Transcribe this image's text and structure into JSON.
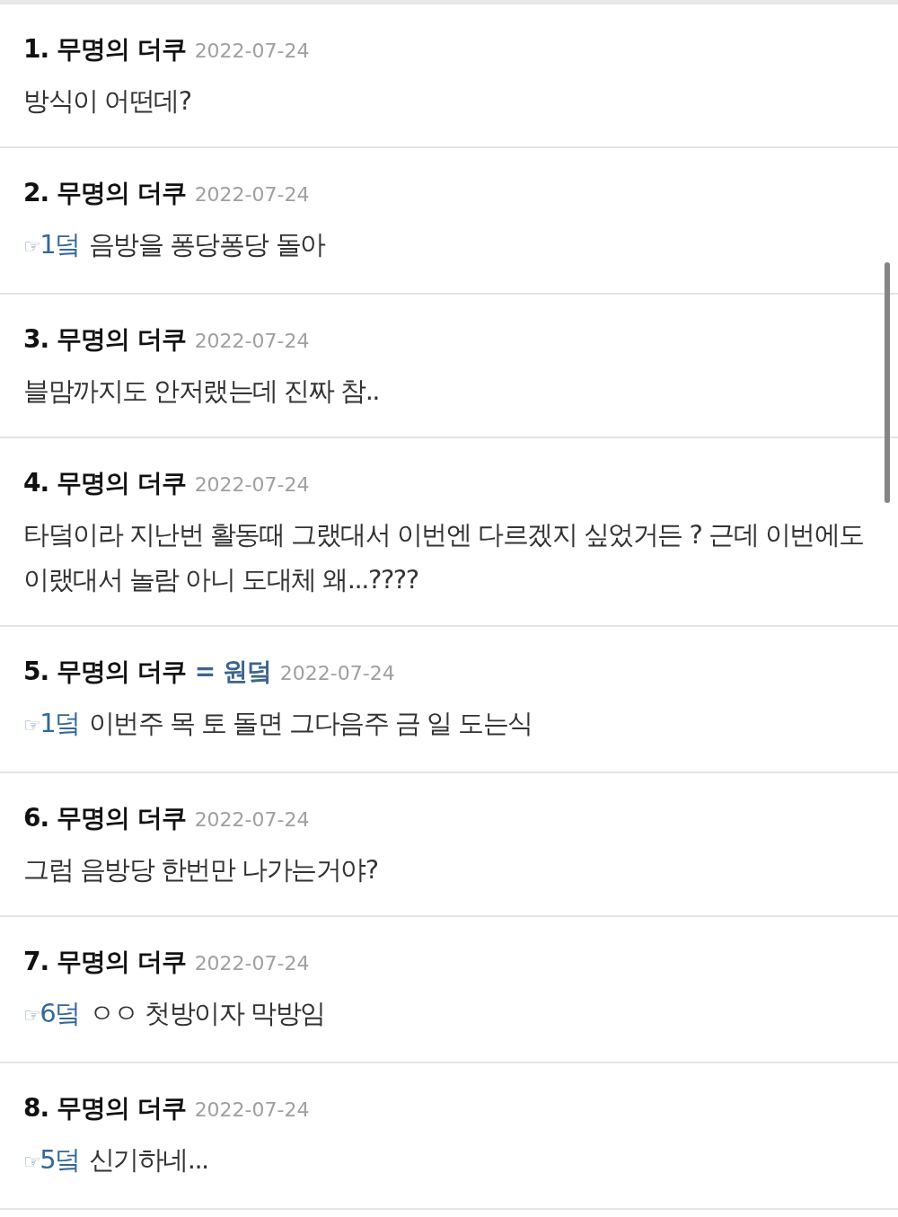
{
  "comments": [
    {
      "number": "1.",
      "author": "무명의 더쿠",
      "date": "2022-07-24",
      "text": "방식이 어떤데?"
    },
    {
      "number": "2.",
      "author": "무명의 더쿠",
      "date": "2022-07-24",
      "reply_icon": "☞",
      "reply_to": "1덬",
      "text": "음방을 퐁당퐁당 돌아"
    },
    {
      "number": "3.",
      "author": "무명의 더쿠",
      "date": "2022-07-24",
      "text": "블맘까지도 안저랬는데 진짜 참.."
    },
    {
      "number": "4.",
      "author": "무명의 더쿠",
      "date": "2022-07-24",
      "text": "타덬이라 지난번 활동때 그랬대서 이번엔 다르겠지 싶었거든 ? 근데 이번에도 이랬대서 놀람 아니 도대체 왜...????"
    },
    {
      "number": "5.",
      "author": "무명의 더쿠",
      "alias": "= 원덬",
      "date": "2022-07-24",
      "reply_icon": "☞",
      "reply_to": "1덬",
      "text": "이번주 목 토 돌면 그다음주 금 일 도는식"
    },
    {
      "number": "6.",
      "author": "무명의 더쿠",
      "date": "2022-07-24",
      "text": "그럼 음방당 한번만 나가는거야?"
    },
    {
      "number": "7.",
      "author": "무명의 더쿠",
      "date": "2022-07-24",
      "reply_icon": "☞",
      "reply_to": "6덬",
      "text": "ㅇㅇ 첫방이자 막방임"
    },
    {
      "number": "8.",
      "author": "무명의 더쿠",
      "date": "2022-07-24",
      "reply_icon": "☞",
      "reply_to": "5덬",
      "text": "신기하네..."
    }
  ]
}
